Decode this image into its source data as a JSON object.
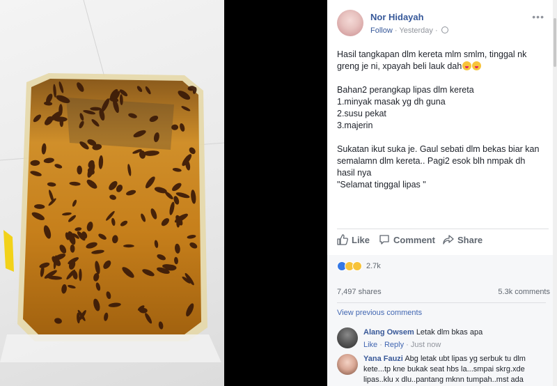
{
  "post": {
    "author": "Nor Hidayah",
    "follow_label": "Follow",
    "timestamp": "Yesterday",
    "more_label": "•••",
    "text_lines_1": [
      "Hasil tangkapan dlm kereta mlm smlm, tinggal nk",
      "greng je ni, xpayah beli lauk dah"
    ],
    "text_lines_2": [
      "Bahan2 perangkap lipas dlm kereta",
      "1.minyak masak yg dh guna",
      "2.susu pekat",
      "3.majerin"
    ],
    "text_lines_3": [
      "Sukatan ikut suka je. Gaul sebati dlm bekas biar kan",
      "semalamn dlm kereta.. Pagi2 esok blh nmpak dh",
      "hasil nya",
      "\"Selamat tinggal lipas \""
    ]
  },
  "actions": {
    "like_label": "Like",
    "comment_label": "Comment",
    "share_label": "Share"
  },
  "stats": {
    "reaction_count": "2.7k",
    "shares": "7,497 shares",
    "comments": "5.3k comments",
    "view_previous": "View previous comments"
  },
  "comments": [
    {
      "name": "Alang Owsem",
      "text": "Letak dlm bkas apa",
      "like_label": "Like",
      "reply_label": "Reply",
      "time": "Just now"
    },
    {
      "name": "Yana Fauzi",
      "text": "Abg letak ubt lipas yg serbuk tu dlm kete...tp kne bukak seat hbs la...smpai skrg.xde lipas..klu x dlu..pantang mknn tumpah..mst ada"
    }
  ],
  "colors": {
    "link_blue": "#365899",
    "text": "#1d2129",
    "muted": "#90949c",
    "oil_amber": "#c8841a"
  }
}
